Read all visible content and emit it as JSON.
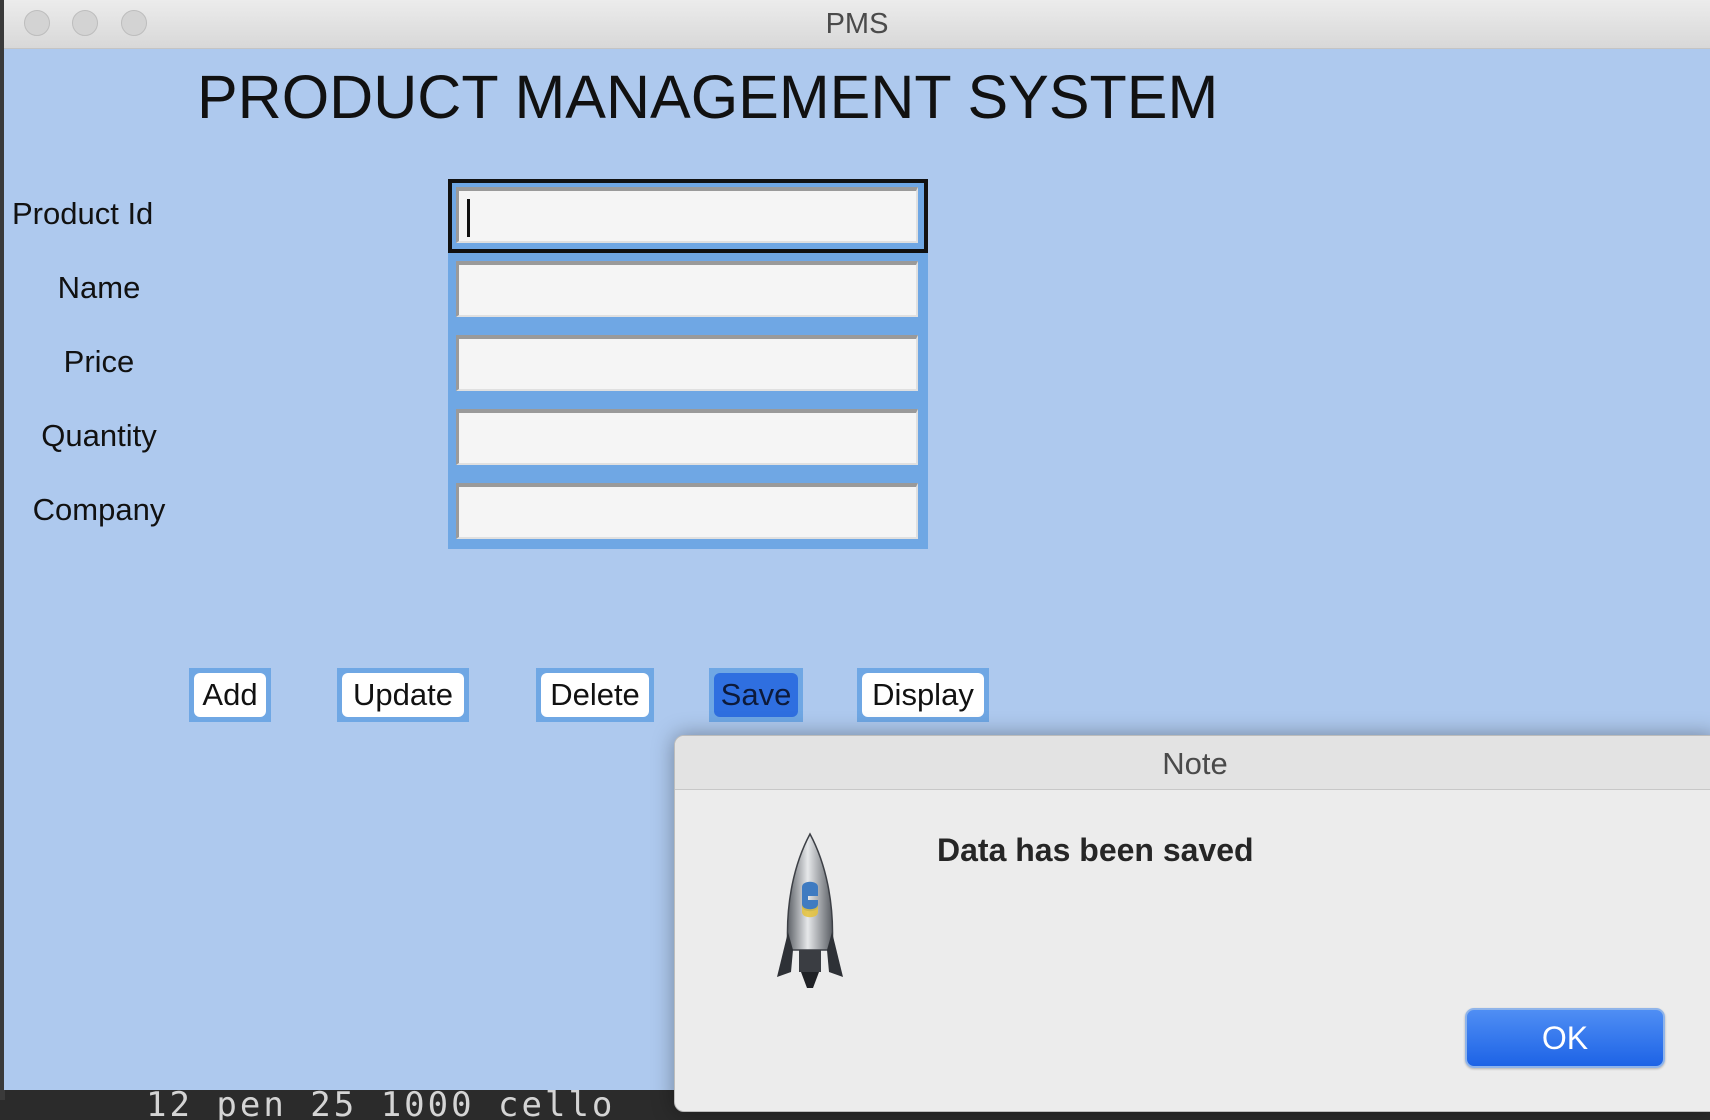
{
  "window": {
    "title": "PMS"
  },
  "app": {
    "heading": "PRODUCT MANAGEMENT SYSTEM"
  },
  "form": {
    "fields": [
      {
        "label": "Product Id",
        "value": ""
      },
      {
        "label": "Name",
        "value": ""
      },
      {
        "label": "Price",
        "value": ""
      },
      {
        "label": "Quantity",
        "value": ""
      },
      {
        "label": "Company",
        "value": ""
      }
    ]
  },
  "buttons": {
    "add": "Add",
    "update": "Update",
    "delete": "Delete",
    "save": "Save",
    "display": "Display"
  },
  "dialog": {
    "title": "Note",
    "message": "Data has been saved",
    "ok_label": "OK",
    "icon": "python-launcher-rocket-icon"
  },
  "terminal": {
    "visible_text": "12 pen 25 1000 cello"
  },
  "colors": {
    "window_bg": "#aec9ee",
    "field_frame": "#6fa7e4",
    "save_active": "#2f6fe0",
    "ok_button": "#1d63e6"
  }
}
